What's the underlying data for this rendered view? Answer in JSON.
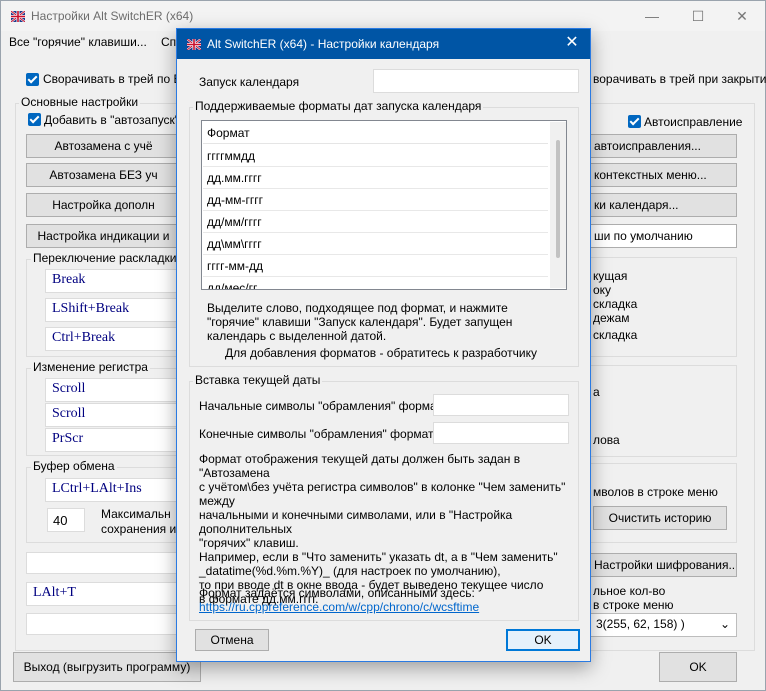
{
  "main": {
    "title": "Настройки Alt SwitchER (x64)",
    "menu": [
      "Все \"горячие\" клавиши...",
      "Сп"
    ],
    "minimize": "—",
    "maximize": "☐",
    "close": "✕",
    "tray_esc_label": "Сворачивать в трей по ESC",
    "tray_close_label": "ворачивать в трей при закрытии",
    "basic_settings_label": "Основные настройки",
    "autostart_label": "Добавить в \"автозапуск\"",
    "autocorrect_label": "Автоисправление",
    "left_buttons": [
      "Автозамена с учё",
      "Автозамена БЕЗ уч",
      "Настройка дополн",
      "Настройка индикации и"
    ],
    "right_buttons": [
      "автоисправления...",
      "контекстных меню...",
      "ки календаря...",
      "ши по умолчанию"
    ],
    "layout_switch_label": "Переключение раскладки",
    "layout_hotkeys": [
      "Break",
      "LShift+Break",
      "Ctrl+Break"
    ],
    "register_label": "Изменение регистра",
    "register_hotkeys": [
      "Scroll",
      "Scroll",
      "PrScr"
    ],
    "clipboard_label": "Буфер обмена",
    "clipboard_hotkey": "LCtrl+LAlt+Ins",
    "clipboard_count": "40",
    "clipboard_max_lines": [
      "Максимальн",
      "сохранения ист"
    ],
    "bottom_hotkey": "LAlt+T",
    "right_frame_lines": [
      "кущая",
      "оку",
      "складка",
      "дежам",
      "складка"
    ],
    "right_mid_lines": [
      "а",
      "лова"
    ],
    "menu_items_label": "мволов в строке меню",
    "clear_history": "Очистить историю",
    "encryption_settings": "Настройки шифрования...",
    "max_count_lines": [
      "льное кол-во",
      "в строке меню"
    ],
    "color_combo": "3(255, 62, 158) )",
    "exit_button": "Выход (выгрузить программу)",
    "ok_button": "OK"
  },
  "dialog": {
    "title": "Alt SwitchER (x64) - Настройки календаря",
    "close": "✕",
    "launch_label": "Запуск календаря",
    "launch_value": "",
    "formats_group": "Поддерживаемые форматы дат запуска календаря",
    "formats_header": "Формат",
    "formats": [
      "ггггммдд",
      "дд.мм.гггг",
      "дд-мм-гггг",
      "дд/мм/гггг",
      "дд\\мм\\гггг",
      "гггг-мм-дд",
      "дд/мес/гг"
    ],
    "formats_hint": "Выделите слово, подходящее под формат, и нажмите \"горячие\" клавиши \"Запуск календаря\". Будет запущен календарь с выделенной датой.",
    "developer_note": "Для добавления форматов - обратитесь к разработчику",
    "insert_group": "Вставка текущей даты",
    "start_symbols_label": "Начальные символы \"обрамления\" формата:",
    "start_symbols_value": "",
    "end_symbols_label": "Конечные символы \"обрамления\" формата:",
    "end_symbols_value": "",
    "description": [
      "Формат отображения текущей даты должен быть задан в \"Автозамена",
      "с учётом\\без учёта регистра символов\" в колонке \"Чем заменить\" между",
      "начальными и конечными символами, или в \"Настройка дополнительных",
      "\"горячих\" клавиш.",
      "Например, если в \"Что заменить\" указать dt, а в \"Чем заменить\"",
      " _datatime(%d.%m.%Y)_ (для настроек по умолчанию),",
      "то при вводе dt в окне ввода - будет выведено текущее число",
      "в формате дд.мм.гггг."
    ],
    "format_note": "Формат задаётся символами, описанными здесь:",
    "link": "https://ru.cppreference.com/w/cpp/chrono/c/wcsftime",
    "cancel": "Отмена",
    "ok": "OK"
  }
}
